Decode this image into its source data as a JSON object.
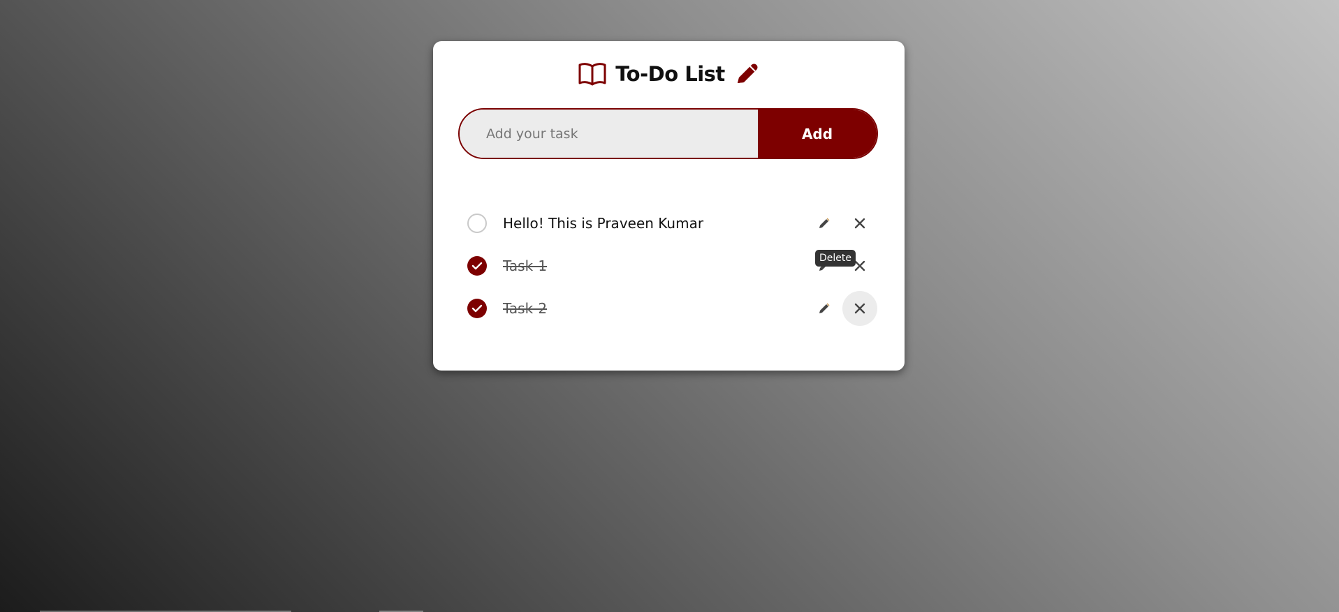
{
  "app": {
    "title": "To-Do List"
  },
  "add_form": {
    "placeholder": "Add your task",
    "value": "",
    "add_label": "Add"
  },
  "tasks": [
    {
      "text": "Hello! This is Praveen Kumar",
      "completed": false
    },
    {
      "text": "Task-1",
      "completed": true
    },
    {
      "text": "Task-2",
      "completed": true
    }
  ],
  "tooltip": {
    "text": "Delete"
  },
  "icons": {
    "header_left": "book-open-icon",
    "header_right": "pencil-icon",
    "edit": "pencil-icon",
    "delete": "close-icon",
    "check": "checkmark-icon"
  },
  "colors": {
    "accent": "#7d0000",
    "card": "#ffffff",
    "input_bg": "#ececec",
    "tooltip_bg": "#333333"
  }
}
